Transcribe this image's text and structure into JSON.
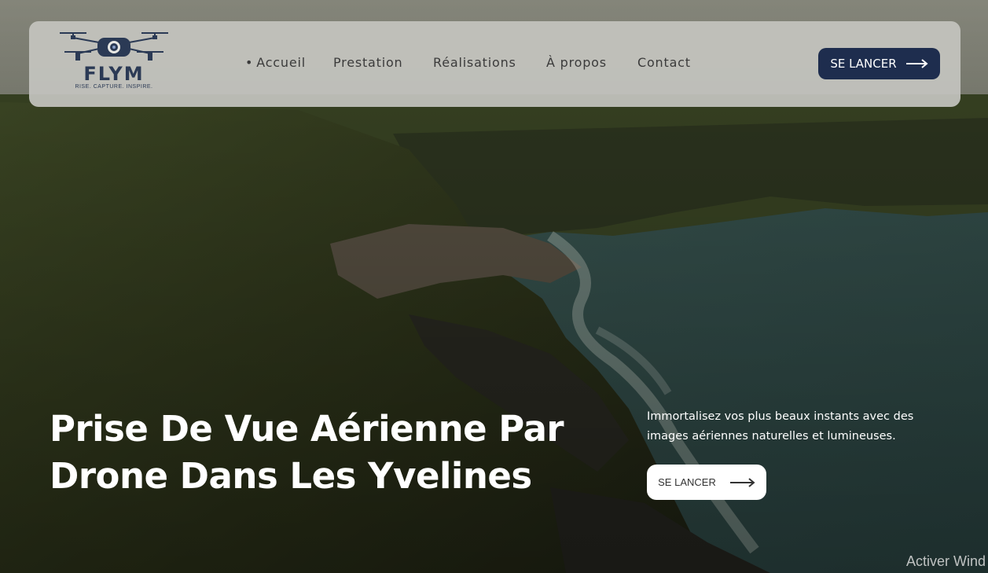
{
  "brand": {
    "name": "FLYM",
    "tagline": "RISE. CAPTURE. INSPIRE."
  },
  "nav": {
    "items": [
      {
        "bullet": "•",
        "label": "Accueil"
      },
      {
        "label": "Prestation"
      },
      {
        "label": "Réalisations"
      },
      {
        "label": "À propos"
      },
      {
        "label": "Contact"
      }
    ],
    "cta_label": "SE LANCER"
  },
  "hero": {
    "title_line1": "Prise De Vue Aérienne Par",
    "title_line2": "Drone Dans Les Yvelines",
    "subtitle": "Immortalisez vos plus beaux instants avec des images aériennes naturelles et lumineuses.",
    "cta_label": "SE LANCER"
  },
  "overlay": {
    "watermark": "Activer Wind"
  },
  "icons": {
    "drone": "drone-logo-icon",
    "arrow": "arrow-right-icon"
  },
  "colors": {
    "primary": "#1e2d4e",
    "navbar": "#c4c4be",
    "text_light": "#ffffff"
  }
}
